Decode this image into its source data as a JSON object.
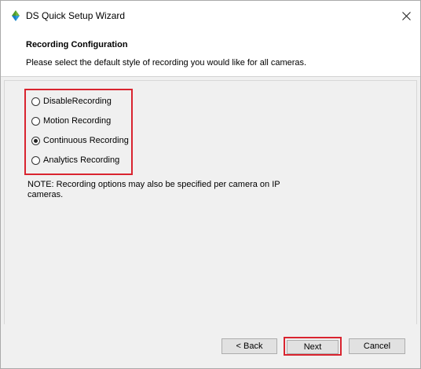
{
  "window": {
    "title": "DS Quick Setup Wizard"
  },
  "header": {
    "title": "Recording Configuration",
    "subtitle": "Please select the default style of recording you would like for all cameras."
  },
  "options": [
    {
      "label": "DisableRecording",
      "selected": false
    },
    {
      "label": "Motion Recording",
      "selected": false
    },
    {
      "label": "Continuous Recording",
      "selected": true
    },
    {
      "label": "Analytics Recording",
      "selected": false
    }
  ],
  "note": "NOTE: Recording options may also be specified per camera on IP cameras.",
  "buttons": {
    "back": "< Back",
    "next": "Next",
    "cancel": "Cancel"
  },
  "colors": {
    "highlight": "#d9242f",
    "icon_top": "#6fb43f",
    "icon_bottom": "#1b7fc4"
  }
}
